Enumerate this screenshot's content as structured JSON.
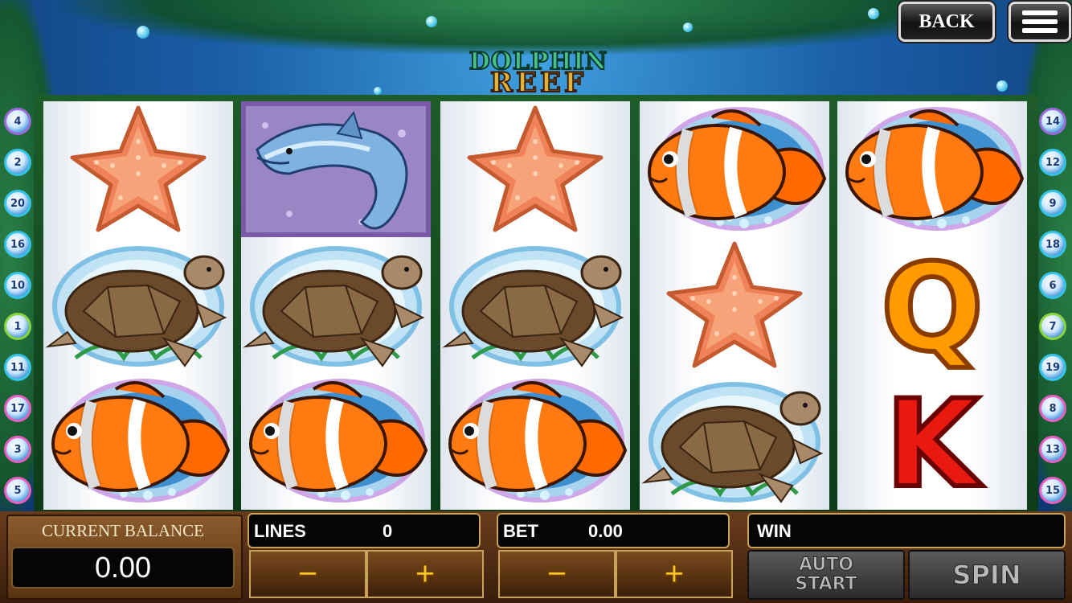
{
  "top_bar": {
    "back_label": "BACK"
  },
  "logo": {
    "line1": "DOLPHIN",
    "line2": "REEF"
  },
  "paylines": {
    "left": [
      "4",
      "2",
      "20",
      "16",
      "10",
      "1",
      "11",
      "17",
      "3",
      "5"
    ],
    "right": [
      "14",
      "12",
      "9",
      "18",
      "6",
      "7",
      "19",
      "8",
      "13",
      "15"
    ]
  },
  "reels": [
    [
      "starfish-icon",
      "sea-turtle-icon",
      "clownfish-icon"
    ],
    [
      "dolphin-icon",
      "sea-turtle-icon",
      "clownfish-icon"
    ],
    [
      "starfish-icon",
      "sea-turtle-icon",
      "clownfish-icon"
    ],
    [
      "clownfish-icon",
      "starfish-icon",
      "sea-turtle-icon"
    ],
    [
      "clownfish-icon",
      "q-icon",
      "k-icon"
    ]
  ],
  "symbol_letters": {
    "q": "Q",
    "k": "K"
  },
  "balance": {
    "label": "CURRENT BALANCE",
    "value": "0.00"
  },
  "lines": {
    "label": "LINES",
    "value": "0",
    "minus": "−",
    "plus": "+"
  },
  "bet": {
    "label": "BET",
    "value": "0.00",
    "minus": "−",
    "plus": "+"
  },
  "win": {
    "label": "WIN",
    "value": ""
  },
  "auto_start": {
    "line1": "AUTO",
    "line2": "START"
  },
  "spin": {
    "label": "SPIN"
  }
}
